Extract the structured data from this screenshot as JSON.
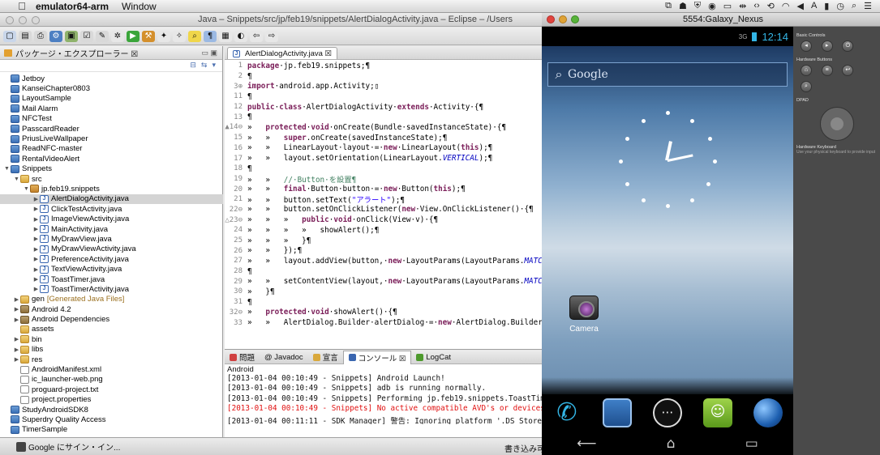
{
  "menubar": {
    "app": "emulator64-arm",
    "menus": [
      "Window"
    ],
    "status_icons": [
      "dropbox-icon",
      "evernote-icon",
      "shield-icon",
      "camera-icon",
      "screen-icon",
      "mirror-icon",
      "clock-icon",
      "wifi-icon",
      "volume-icon",
      "input-icon",
      "battery-icon",
      "time-icon",
      "search-icon",
      "list-icon"
    ]
  },
  "eclipse": {
    "title": "Java – Snippets/src/jp/feb19/snippets/AlertDialogActivity.java – Eclipse – /Users",
    "package_explorer_title": "パッケージ・エクスプローラー ☒",
    "tree": [
      {
        "label": "Jetboy",
        "indent": 0,
        "icon": "proj",
        "arrow": ""
      },
      {
        "label": "KanseiChapter0803",
        "indent": 0,
        "icon": "proj",
        "arrow": ""
      },
      {
        "label": "LayoutSample",
        "indent": 0,
        "icon": "proj",
        "arrow": ""
      },
      {
        "label": "Mail Alarm",
        "indent": 0,
        "icon": "proj",
        "arrow": ""
      },
      {
        "label": "NFCTest",
        "indent": 0,
        "icon": "proj",
        "arrow": ""
      },
      {
        "label": "PasscardReader",
        "indent": 0,
        "icon": "proj",
        "arrow": ""
      },
      {
        "label": "PriusLiveWallpaper",
        "indent": 0,
        "icon": "proj",
        "arrow": ""
      },
      {
        "label": "ReadNFC-master",
        "indent": 0,
        "icon": "proj",
        "arrow": ""
      },
      {
        "label": "RentalVideoAlert",
        "indent": 0,
        "icon": "proj",
        "arrow": ""
      },
      {
        "label": "Snippets",
        "indent": 0,
        "icon": "proj",
        "arrow": "▼"
      },
      {
        "label": "src",
        "indent": 1,
        "icon": "folder",
        "arrow": "▼"
      },
      {
        "label": "jp.feb19.snippets",
        "indent": 2,
        "icon": "pkg",
        "arrow": "▼"
      },
      {
        "label": "AlertDialogActivity.java",
        "indent": 3,
        "icon": "java",
        "arrow": "▶",
        "selected": true
      },
      {
        "label": "ClickTestActivity.java",
        "indent": 3,
        "icon": "java",
        "arrow": "▶"
      },
      {
        "label": "ImageViewActivity.java",
        "indent": 3,
        "icon": "java",
        "arrow": "▶"
      },
      {
        "label": "MainActivity.java",
        "indent": 3,
        "icon": "java",
        "arrow": "▶"
      },
      {
        "label": "MyDrawView.java",
        "indent": 3,
        "icon": "java",
        "arrow": "▶"
      },
      {
        "label": "MyDrawViewActivity.java",
        "indent": 3,
        "icon": "java",
        "arrow": "▶"
      },
      {
        "label": "PreferenceActivity.java",
        "indent": 3,
        "icon": "java",
        "arrow": "▶"
      },
      {
        "label": "TextViewActivity.java",
        "indent": 3,
        "icon": "java",
        "arrow": "▶"
      },
      {
        "label": "ToastTimer.java",
        "indent": 3,
        "icon": "java",
        "arrow": "▶"
      },
      {
        "label": "ToastTimerActivity.java",
        "indent": 3,
        "icon": "java",
        "arrow": "▶"
      },
      {
        "label": "gen",
        "extra": "[Generated Java Files]",
        "indent": 1,
        "icon": "folder",
        "arrow": "▶"
      },
      {
        "label": "Android 4.2",
        "indent": 1,
        "icon": "lib",
        "arrow": "▶"
      },
      {
        "label": "Android Dependencies",
        "indent": 1,
        "icon": "lib",
        "arrow": "▶"
      },
      {
        "label": "assets",
        "indent": 1,
        "icon": "folder",
        "arrow": ""
      },
      {
        "label": "bin",
        "indent": 1,
        "icon": "folder",
        "arrow": "▶"
      },
      {
        "label": "libs",
        "indent": 1,
        "icon": "folder",
        "arrow": "▶"
      },
      {
        "label": "res",
        "indent": 1,
        "icon": "folder",
        "arrow": "▶"
      },
      {
        "label": "AndroidManifest.xml",
        "indent": 1,
        "icon": "file",
        "arrow": ""
      },
      {
        "label": "ic_launcher-web.png",
        "indent": 1,
        "icon": "file",
        "arrow": ""
      },
      {
        "label": "proguard-project.txt",
        "indent": 1,
        "icon": "file",
        "arrow": ""
      },
      {
        "label": "project.properties",
        "indent": 1,
        "icon": "file",
        "arrow": ""
      },
      {
        "label": "StudyAndroidSDK8",
        "indent": 0,
        "icon": "proj",
        "arrow": ""
      },
      {
        "label": "Superdry Quality Access",
        "indent": 0,
        "icon": "proj",
        "arrow": ""
      },
      {
        "label": "TimerSample",
        "indent": 0,
        "icon": "proj",
        "arrow": ""
      }
    ],
    "editor_tab": "AlertDialogActivity.java ☒",
    "code": [
      {
        "n": "1",
        "html": "<span class='kw'>package</span>·jp.feb19.snippets;¶"
      },
      {
        "n": "2",
        "html": "¶"
      },
      {
        "n": "3⊕",
        "html": "<span class='kw'>import</span>·android.app.Activity;▯"
      },
      {
        "n": "11",
        "html": "¶"
      },
      {
        "n": "12",
        "html": "<span class='kw'>public</span>·<span class='kw'>class</span>·AlertDialogActivity·<span class='kw'>extends</span>·Activity·{¶"
      },
      {
        "n": "13",
        "html": "¶"
      },
      {
        "n": "▲14⊖",
        "html": "»   <span class='kw'>protected</span>·<span class='kw'>void</span>·onCreate(Bundle·savedInstanceState)·{¶"
      },
      {
        "n": "15",
        "html": "»   »   <span class='kw'>super</span>.onCreate(savedInstanceState);¶"
      },
      {
        "n": "16",
        "html": "»   »   LinearLayout·layout·=·<span class='kw'>new</span>·LinearLayout(<span class='kw'>this</span>);¶"
      },
      {
        "n": "17",
        "html": "»   »   layout.setOrientation(LinearLayout.<span class='it'>VERTICAL</span>);¶"
      },
      {
        "n": "18",
        "html": "¶"
      },
      {
        "n": "19",
        "html": "»   »   <span class='cm'>//·Button·を設置¶</span>"
      },
      {
        "n": "20",
        "html": "»   »   <span class='kw'>final</span>·Button·button·=·<span class='kw'>new</span>·Button(<span class='kw'>this</span>);¶"
      },
      {
        "n": "21",
        "html": "»   »   button.setText(<span class='st'>\"アラート\"</span>);¶"
      },
      {
        "n": "22⊖",
        "html": "»   »   button.setOnClickListener(<span class='kw'>new</span>·View.OnClickListener()·{¶"
      },
      {
        "n": "△23⊖",
        "html": "»   »   »   <span class='kw'>public</span>·<span class='kw'>void</span>·onClick(View·v)·{¶"
      },
      {
        "n": "24",
        "html": "»   »   »   »   showAlert();¶"
      },
      {
        "n": "25",
        "html": "»   »   »   }¶"
      },
      {
        "n": "26",
        "html": "»   »   });¶"
      },
      {
        "n": "27",
        "html": "»   »   layout.addView(button,·<span class='kw'>new</span>·LayoutParams(LayoutParams.<span class='it'>MATC</span>"
      },
      {
        "n": "28",
        "html": "¶"
      },
      {
        "n": "29",
        "html": "»   »   setContentView(layout,·<span class='kw'>new</span>·LayoutParams(LayoutParams.<span class='it'>MATC</span>"
      },
      {
        "n": "30",
        "html": "»   }¶"
      },
      {
        "n": "31",
        "html": "¶"
      },
      {
        "n": "32⊖",
        "html": "»   <span class='kw'>protected</span>·<span class='kw'>void</span>·showAlert()·{¶"
      },
      {
        "n": "33",
        "html": "»   »   AlertDialog.Builder·alertDialog·=·<span class='kw'>new</span>·AlertDialog.Builder"
      }
    ],
    "console_tabs": [
      "問題",
      "@ Javadoc",
      "宣言",
      "コンソール ☒",
      "LogCat"
    ],
    "console_label": "Android",
    "console_lines": [
      {
        "text": "[2013-01-04 00:10:49 - Snippets] Android Launch!",
        "err": false
      },
      {
        "text": "[2013-01-04 00:10:49 - Snippets] adb is running normally.",
        "err": false
      },
      {
        "text": "[2013-01-04 00:10:49 - Snippets] Performing jp.feb19.snippets.ToastTim",
        "err": false
      },
      {
        "text": "[2013-01-04 00:10:49 - Snippets] No active compatible AVD's or devices",
        "err": true
      },
      {
        "text": "[2013-01-04 00:11:11 - SDK Manager] 警告: Ignoring platform '.DS_Store",
        "err": false
      }
    ],
    "statusbar_google": "Google にサイン・イン...",
    "statusbar_write": "書き込み可能"
  },
  "emulator": {
    "window_title": "5554:Galaxy_Nexus",
    "time": "12:14",
    "signal": "3G",
    "search_placeholder": "Google",
    "app_label": "Camera",
    "controls_basic": "Basic Controls",
    "controls_hw": "Hardware Buttons",
    "controls_dpad": "DPAD",
    "controls_kb": "Hardware Keyboard",
    "controls_kb_sub": "Use your physical keyboard to provide input"
  }
}
